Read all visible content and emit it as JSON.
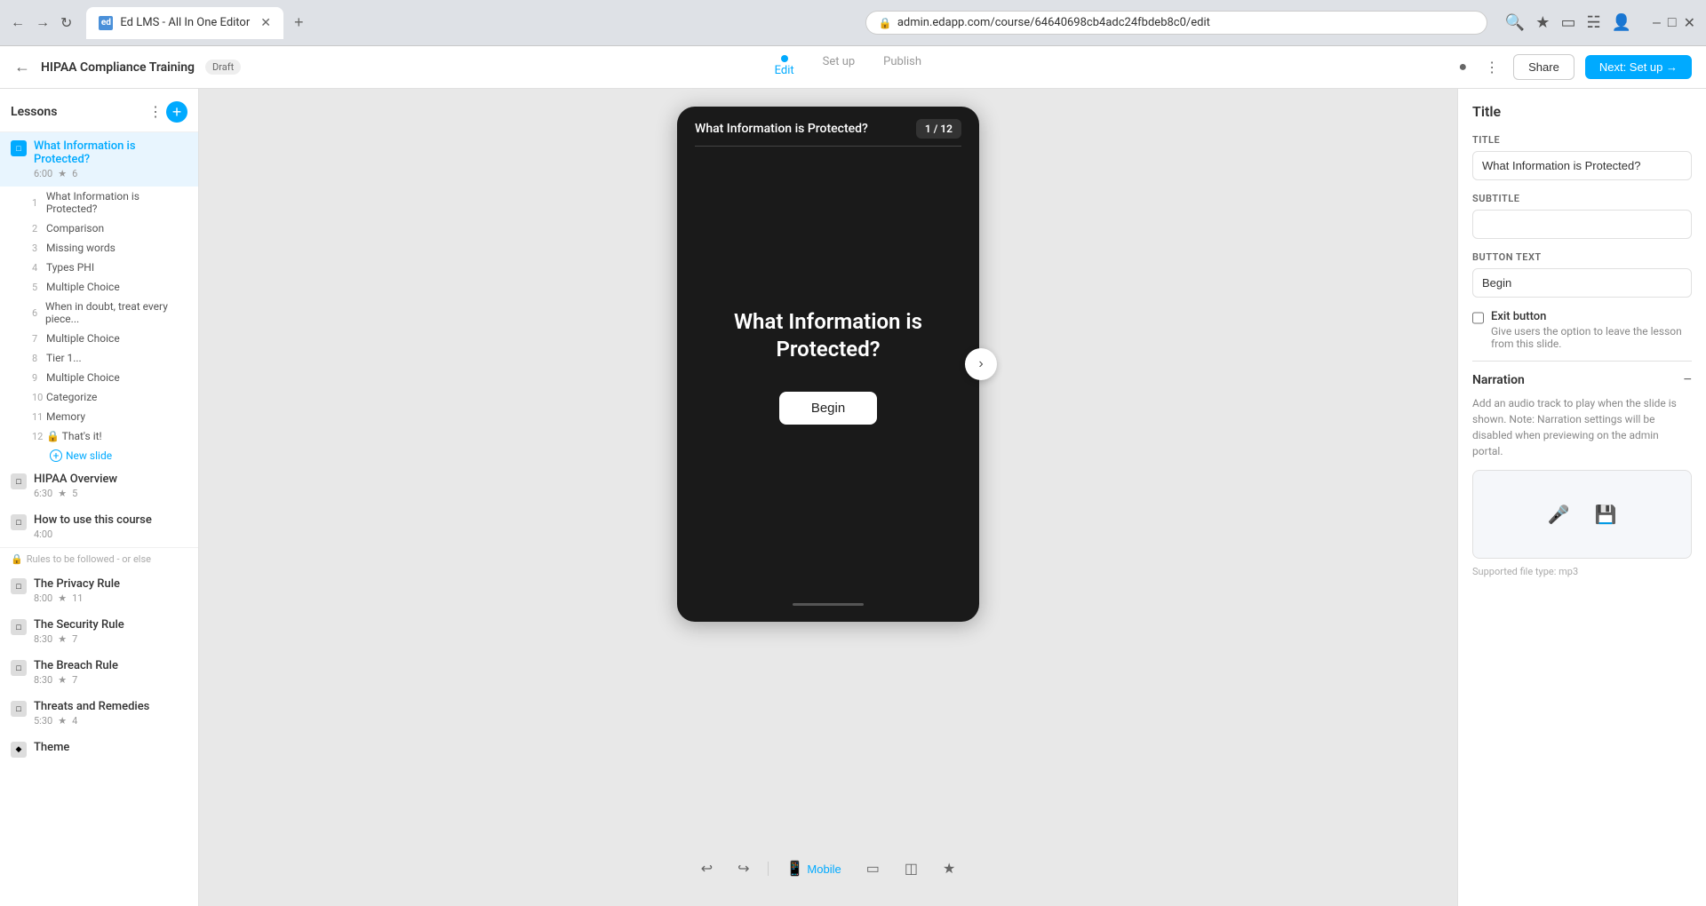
{
  "browser": {
    "tab_label": "Ed LMS - All In One Editor",
    "url": "admin.edapp.com/course/64640698cb4adc24fbdeb8c0/edit",
    "new_tab_label": "+"
  },
  "app_bar": {
    "back_label": "←",
    "course_title": "HIPAA Compliance Training",
    "draft_label": "Draft",
    "steps": [
      {
        "label": "Edit",
        "active": true
      },
      {
        "label": "Set up",
        "active": false
      },
      {
        "label": "Publish",
        "active": false
      }
    ],
    "share_label": "Share",
    "next_label": "Next: Set up →"
  },
  "sidebar": {
    "title": "Lessons",
    "add_label": "+",
    "lessons": [
      {
        "name": "What Information is Protected?",
        "time": "6:00",
        "stars": "6",
        "active": true,
        "slides": [
          {
            "num": "1",
            "label": "What Information is Protected?"
          },
          {
            "num": "2",
            "label": "Comparison"
          },
          {
            "num": "3",
            "label": "Missing words"
          },
          {
            "num": "4",
            "label": "Types PHI"
          },
          {
            "num": "5",
            "label": "Multiple Choice"
          },
          {
            "num": "6",
            "label": "When in doubt, treat every piece..."
          },
          {
            "num": "7",
            "label": "Multiple Choice"
          },
          {
            "num": "8",
            "label": "Tier 1..."
          },
          {
            "num": "9",
            "label": "Multiple Choice"
          },
          {
            "num": "10",
            "label": "Categorize"
          },
          {
            "num": "11",
            "label": "Memory"
          },
          {
            "num": "12",
            "label": "That's it!"
          }
        ],
        "new_slide_label": "New slide"
      },
      {
        "name": "HIPAA Overview",
        "time": "6:30",
        "stars": "5",
        "active": false,
        "slides": []
      },
      {
        "name": "How to use this course",
        "time": "4:00",
        "stars": "",
        "active": false,
        "slides": []
      }
    ],
    "section_divider": "Rules to be followed - or else",
    "extra_lessons": [
      {
        "name": "The Privacy Rule",
        "time": "8:00",
        "stars": "11"
      },
      {
        "name": "The Security Rule",
        "time": "8:30",
        "stars": "7"
      },
      {
        "name": "The Breach Rule",
        "time": "8:30",
        "stars": "7"
      },
      {
        "name": "Threats and Remedies",
        "time": "5:30",
        "stars": "4"
      }
    ],
    "theme_label": "Theme"
  },
  "phone": {
    "lesson_title": "What Information is Protected?",
    "progress": "1 / 12",
    "main_text": "What Information is Protected?",
    "begin_label": "Begin"
  },
  "bottom_toolbar": {
    "undo_icon": "↩",
    "redo_icon": "↪",
    "mobile_label": "Mobile",
    "icons": [
      "▭",
      "☁",
      "★"
    ]
  },
  "right_panel": {
    "title": "Title",
    "title_label": "TITLE",
    "title_value": "What Information is Protected?",
    "subtitle_label": "SUBTITLE",
    "subtitle_value": "",
    "button_text_label": "BUTTON TEXT",
    "button_text_value": "Begin",
    "exit_button_label": "Exit button",
    "exit_button_desc": "Give users the option to leave the lesson from this slide.",
    "narration_label": "Narration",
    "narration_desc": "Add an audio track to play when the slide is shown. Note: Narration settings will be disabled when previewing on the admin portal.",
    "audio_hint": "Supported file type: mp3"
  }
}
